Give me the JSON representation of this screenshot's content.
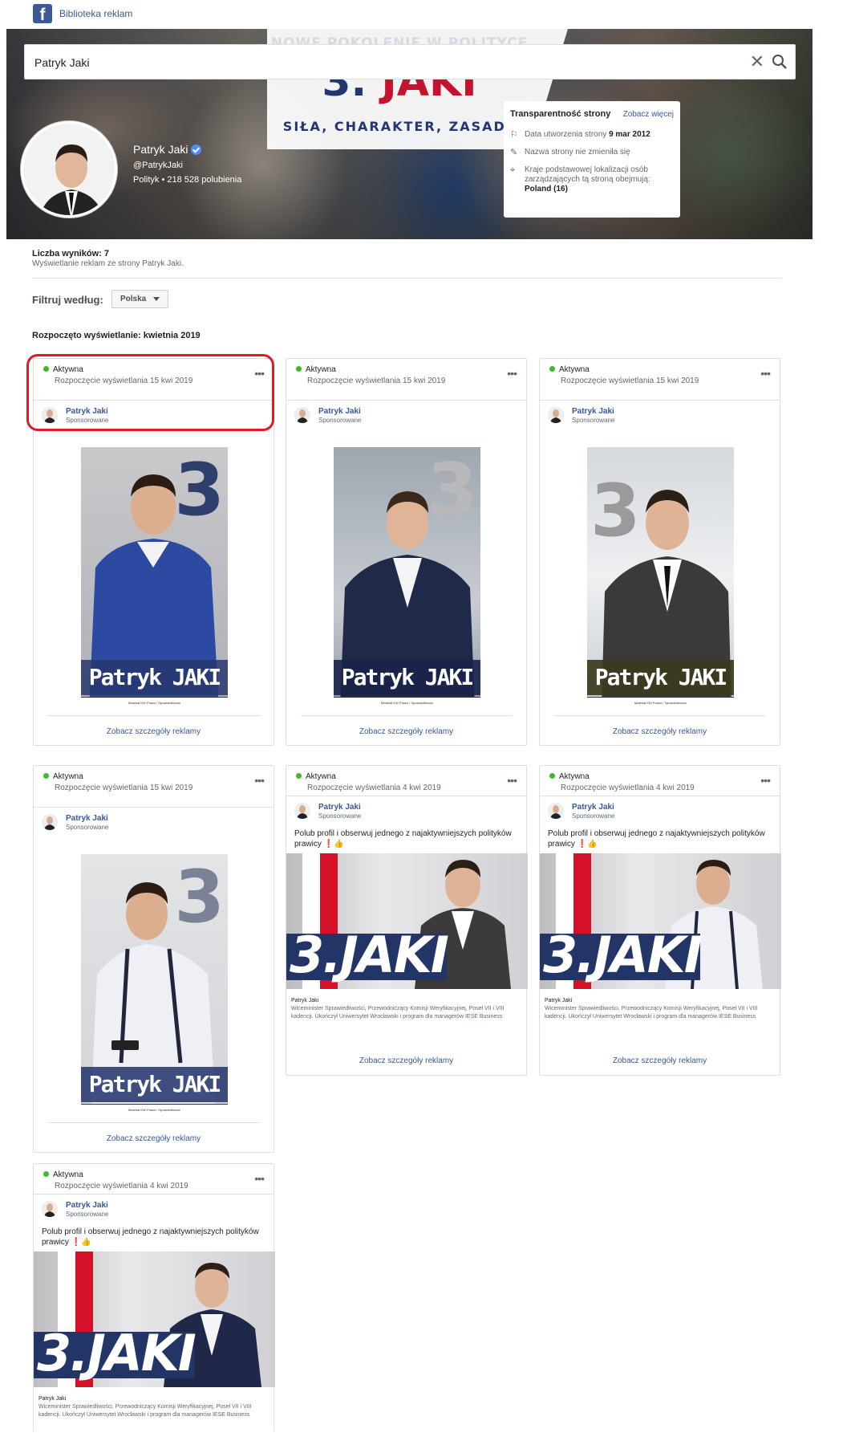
{
  "app": {
    "title": "Biblioteka reklam",
    "logo": "f"
  },
  "search": {
    "value": "Patryk Jaki",
    "clear_icon": "close-icon",
    "search_icon": "search-icon"
  },
  "cover": {
    "banner_top": "NOWE POKOLENIE W POLITYCE",
    "banner_number": "3.",
    "banner_name": "JAKI",
    "banner_slogan": "SIŁA, CHARAKTER, ZASADY"
  },
  "page": {
    "name": "Patryk Jaki",
    "handle": "@PatrykJaki",
    "category": "Polityk",
    "likes": "218 528 polubienia",
    "separator": "•"
  },
  "transparency": {
    "title": "Transparentność strony",
    "more": "Zobacz więcej",
    "created_label": "Data utworzenia strony",
    "created_date": "9 mar 2012",
    "name_unchanged": "Nazwa strony nie zmieniła się",
    "countries": "Kraje podstawowej lokalizacji osób zarządzających tą stroną obejmują:",
    "countries_value": "Poland (16)"
  },
  "results": {
    "count_label": "Liczba wyników: 7",
    "subtitle": "Wyświetlanie reklam ze strony Patryk Jaki."
  },
  "filter": {
    "label": "Filtruj według:",
    "value": "Polska"
  },
  "section_title": "Rozpoczęto wyświetlanie: kwietnia 2019",
  "colors": {
    "accent": "#385898",
    "active": "#42b72a",
    "highlight": "#e01b22",
    "navy": "#233466",
    "red": "#d41128"
  },
  "ads": [
    {
      "status": "Aktywna",
      "started": "Rozpoczęcie wyświetlania 15 kwi 2019",
      "advertiser": "Patryk Jaki",
      "sponsored": "Sponsorowane",
      "poster_text": "Patryk JAKI",
      "poster_digit": "3",
      "poster_foot": "Materiał KW Prawo i Sprawiedliwość",
      "details": "Zobacz szczegóły reklamy"
    },
    {
      "status": "Aktywna",
      "started": "Rozpoczęcie wyświetlania 15 kwi 2019",
      "advertiser": "Patryk Jaki",
      "sponsored": "Sponsorowane",
      "poster_text": "Patryk JAKI",
      "poster_digit": "3",
      "poster_foot": "Materiał KW Prawo i Sprawiedliwość",
      "details": "Zobacz szczegóły reklamy"
    },
    {
      "status": "Aktywna",
      "started": "Rozpoczęcie wyświetlania 15 kwi 2019",
      "advertiser": "Patryk Jaki",
      "sponsored": "Sponsorowane",
      "poster_text": "Patryk JAKI",
      "poster_digit": "3",
      "poster_foot": "Materiał KW Prawo i Sprawiedliwość",
      "details": "Zobacz szczegóły reklamy"
    },
    {
      "status": "Aktywna",
      "started": "Rozpoczęcie wyświetlania 15 kwi 2019",
      "advertiser": "Patryk Jaki",
      "sponsored": "Sponsorowane",
      "poster_text": "Patryk JAKI",
      "poster_digit": "3",
      "poster_foot": "Materiał KW Prawo i Sprawiedliwość",
      "details": "Zobacz szczegóły reklamy"
    },
    {
      "status": "Aktywna",
      "started": "Rozpoczęcie wyświetlania 4 kwi 2019",
      "advertiser": "Patryk Jaki",
      "sponsored": "Sponsorowane",
      "body": "Polub profil i obserwuj jednego z najaktywniejszych polityków prawicy ❗👍",
      "image_text": "3.JAKI",
      "caption_title": "Patryk Jaki",
      "caption": "Wiceminister Sprawiedliwości, Przewodniczący Komisji Weryfikacyjnej, Poseł VII i VIII kadencji. Ukończył Uniwersytet Wrocławski i program dla managerów IESE Business",
      "details": "Zobacz szczegóły reklamy"
    },
    {
      "status": "Aktywna",
      "started": "Rozpoczęcie wyświetlania 4 kwi 2019",
      "advertiser": "Patryk Jaki",
      "sponsored": "Sponsorowane",
      "body": "Polub profil i obserwuj jednego z najaktywniejszych polityków prawicy ❗👍",
      "image_text": "3.JAKI",
      "caption_title": "Patryk Jaki",
      "caption": "Wiceminister Sprawiedliwości, Przewodniczący Komisji Weryfikacyjnej, Poseł VII i VIII kadencji. Ukończył Uniwersytet Wrocławski i program dla managerów IESE Business",
      "details": "Zobacz szczegóły reklamy"
    },
    {
      "status": "Aktywna",
      "started": "Rozpoczęcie wyświetlania 4 kwi 2019",
      "advertiser": "Patryk Jaki",
      "sponsored": "Sponsorowane",
      "body": "Polub profil i obserwuj jednego z najaktywniejszych polityków prawicy ❗👍",
      "image_text": "3.JAKI",
      "caption_title": "Patryk Jaki",
      "caption": "Wiceminister Sprawiedliwości, Przewodniczący Komisji Weryfikacyjnej, Poseł VII i VIII kadencji. Ukończył Uniwersytet Wrocławski i program dla managerów IESE Business"
    }
  ]
}
